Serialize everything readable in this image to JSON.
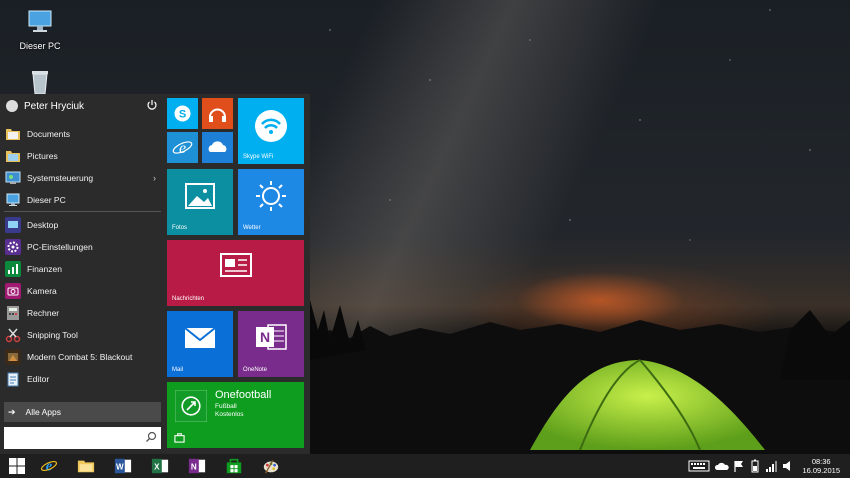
{
  "desktop": {
    "icons": [
      {
        "label": "Dieser PC",
        "icon": "computer-icon"
      },
      {
        "label": "",
        "icon": "recycle-bin-icon"
      }
    ]
  },
  "start_menu": {
    "user_name": "Peter Hryciuk",
    "power_icon": "power-icon",
    "places": [
      {
        "label": "Documents",
        "icon": "folder-icon"
      },
      {
        "label": "Pictures",
        "icon": "folder-icon"
      },
      {
        "label": "Systemsteuerung",
        "icon": "control-panel-icon",
        "has_submenu": true
      },
      {
        "label": "Dieser PC",
        "icon": "computer-icon"
      }
    ],
    "submenu_chevron": "›",
    "apps": [
      {
        "label": "Desktop",
        "icon": "desktop-icon",
        "color": "#3a3a8c"
      },
      {
        "label": "PC-Einstellungen",
        "icon": "gear-icon",
        "color": "#5b2e91"
      },
      {
        "label": "Finanzen",
        "icon": "finance-icon",
        "color": "#0b8a3d"
      },
      {
        "label": "Kamera",
        "icon": "camera-icon",
        "color": "#a01a72"
      },
      {
        "label": "Rechner",
        "icon": "calculator-icon",
        "color": "#555555"
      },
      {
        "label": "Snipping Tool",
        "icon": "scissors-icon",
        "color": "#888888"
      },
      {
        "label": "Modern Combat 5: Blackout",
        "icon": "game-icon",
        "color": "#3a2a1a"
      },
      {
        "label": "Editor",
        "icon": "notepad-icon",
        "color": "#4a7fb5"
      }
    ],
    "all_apps_arrow": "➔",
    "all_apps_label": "Alle Apps",
    "search_placeholder": ""
  },
  "tiles": {
    "skype_label": "",
    "music_label": "",
    "ie_label": "",
    "onedrive_label": "",
    "skype_wifi_label": "Skype WiFi",
    "fotos_label": "Fotos",
    "wetter_label": "Wetter",
    "nachrichten_label": "Nachrichten",
    "mail_label": "Mail",
    "onenote_label": "OneNote",
    "onefootball": {
      "title": "Onefootball",
      "line1": "Fußball",
      "line2": "Kostenlos"
    },
    "colors": {
      "skype": "#00aff0",
      "music": "#e04e1b",
      "ie": "#1e90d6",
      "onedrive": "#1e7fd6",
      "fotos": "#0c8fa0",
      "wetter": "#1e88e5",
      "nachrichten": "#b81c46",
      "mail": "#0a6fd6",
      "onenote": "#7a2c8c",
      "store": "#0f9d1f"
    }
  },
  "taskbar": {
    "apps": [
      {
        "icon": "windows-start-icon"
      },
      {
        "icon": "internet-explorer-icon"
      },
      {
        "icon": "file-explorer-icon"
      },
      {
        "icon": "word-icon"
      },
      {
        "icon": "excel-icon"
      },
      {
        "icon": "onenote-icon"
      },
      {
        "icon": "store-icon"
      },
      {
        "icon": "paint-icon"
      }
    ],
    "tray": [
      "keyboard-icon",
      "onedrive-tray-icon",
      "flag-icon",
      "battery-icon",
      "signal-icon",
      "volume-icon"
    ],
    "time": "08:36",
    "date": "16.09.2015"
  }
}
